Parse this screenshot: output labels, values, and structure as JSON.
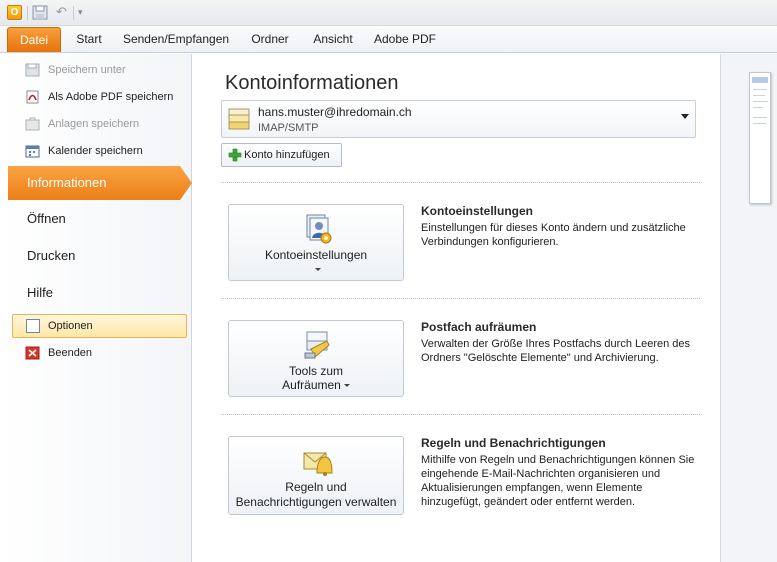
{
  "quick_access": {
    "app_letter": "O",
    "icons": [
      "outlook-app-icon",
      "save-icon",
      "undo-icon",
      "customize-icon"
    ]
  },
  "ribbon": {
    "tabs": [
      "Datei",
      "Start",
      "Senden/Empfangen",
      "Ordner",
      "Ansicht",
      "Adobe PDF"
    ],
    "active_tab": "Datei"
  },
  "backstage": {
    "commands_top": [
      {
        "label": "Speichern unter",
        "enabled": false,
        "icon": "save-as-icon"
      },
      {
        "label": "Als Adobe PDF speichern",
        "enabled": true,
        "icon": "adobe-pdf-icon"
      },
      {
        "label": "Anlagen speichern",
        "enabled": false,
        "icon": "attachments-icon"
      },
      {
        "label": "Kalender speichern",
        "enabled": true,
        "icon": "calendar-icon"
      }
    ],
    "tabs": [
      {
        "label": "Informationen",
        "active": true
      },
      {
        "label": "Öffnen",
        "active": false
      },
      {
        "label": "Drucken",
        "active": false
      },
      {
        "label": "Hilfe",
        "active": false
      }
    ],
    "commands_bottom": [
      {
        "label": "Optionen",
        "icon": "options-icon",
        "highlighted": true
      },
      {
        "label": "Beenden",
        "icon": "exit-icon",
        "highlighted": false
      }
    ]
  },
  "main": {
    "title": "Kontoinformationen",
    "account": {
      "email": "hans.muster@ihredomain.ch",
      "type": "IMAP/SMTP"
    },
    "add_account_label": "Konto hinzufügen",
    "sections": [
      {
        "button_lines": [
          "Kontoeinstellungen"
        ],
        "has_dropdown": true,
        "icon": "account-settings-icon",
        "title": "Kontoeinstellungen",
        "description": "Einstellungen für dieses Konto ändern und zusätzliche Verbindungen konfigurieren."
      },
      {
        "button_lines": [
          "Tools zum",
          "Aufräumen"
        ],
        "has_dropdown": true,
        "icon": "cleanup-tools-icon",
        "title": "Postfach aufräumen",
        "description": "Verwalten der Größe Ihres Postfachs durch Leeren des Ordners \"Gelöschte Elemente\" und Archivierung."
      },
      {
        "button_lines": [
          "Regeln und",
          "Benachrichtigungen verwalten"
        ],
        "has_dropdown": false,
        "icon": "rules-alerts-icon",
        "title": "Regeln und Benachrichtigungen",
        "description": "Mithilfe von Regeln und Benachrichtigungen können Sie eingehende E-Mail-Nachrichten organisieren und Aktualisierungen empfangen, wenn Elemente hinzugefügt, geändert oder entfernt werden."
      }
    ]
  }
}
